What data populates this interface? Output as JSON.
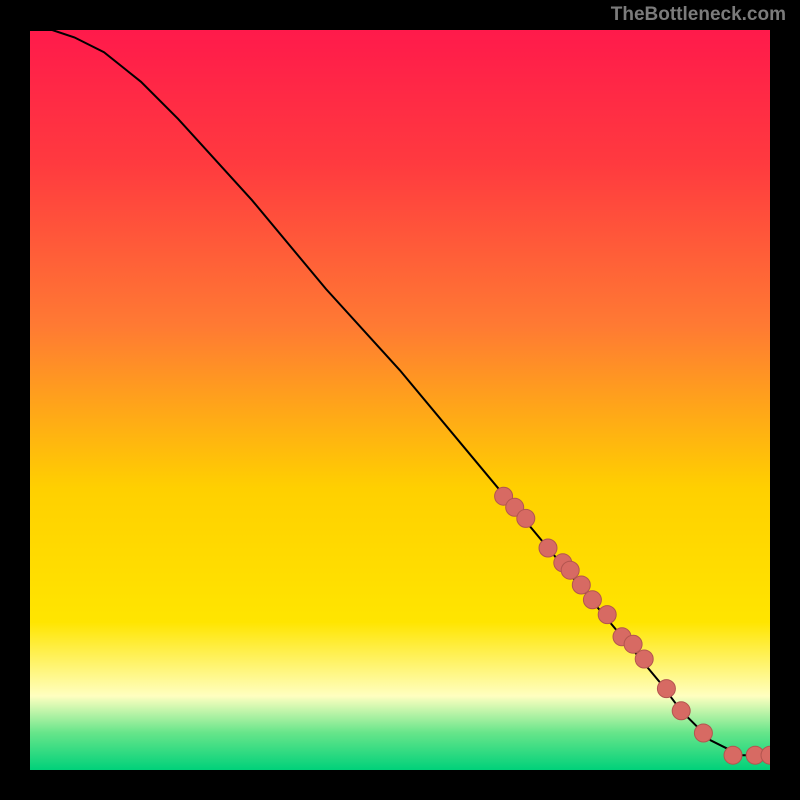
{
  "watermark": "TheBottleneck.com",
  "colors": {
    "red_top": "#ff1a4b",
    "orange": "#ff7a33",
    "yellow": "#ffe500",
    "pale_yellow": "#ffffc0",
    "green_light": "#66e58a",
    "green": "#00d17a",
    "curve": "#000000",
    "marker_fill": "#d76a63",
    "marker_stroke": "#b3554f",
    "frame": "#000000"
  },
  "chart_data": {
    "type": "line",
    "title": "",
    "xlabel": "",
    "ylabel": "",
    "xlim": [
      0,
      100
    ],
    "ylim": [
      0,
      100
    ],
    "curve": {
      "x": [
        0,
        3,
        6,
        10,
        15,
        20,
        30,
        40,
        50,
        60,
        65,
        70,
        75,
        80,
        85,
        88,
        90,
        92,
        94,
        96,
        98,
        100
      ],
      "y": [
        100,
        100,
        99,
        97,
        93,
        88,
        77,
        65,
        54,
        42,
        36,
        30,
        24,
        18,
        12,
        8,
        6,
        4,
        3,
        2,
        2,
        2
      ]
    },
    "markers": {
      "x": [
        64,
        65.5,
        67,
        70,
        72,
        73,
        74.5,
        76,
        78,
        80,
        81.5,
        83,
        86,
        88,
        91,
        95,
        98,
        100
      ],
      "y": [
        37,
        35.5,
        34,
        30,
        28,
        27,
        25,
        23,
        21,
        18,
        17,
        15,
        11,
        8,
        5,
        2,
        2,
        2
      ]
    }
  }
}
